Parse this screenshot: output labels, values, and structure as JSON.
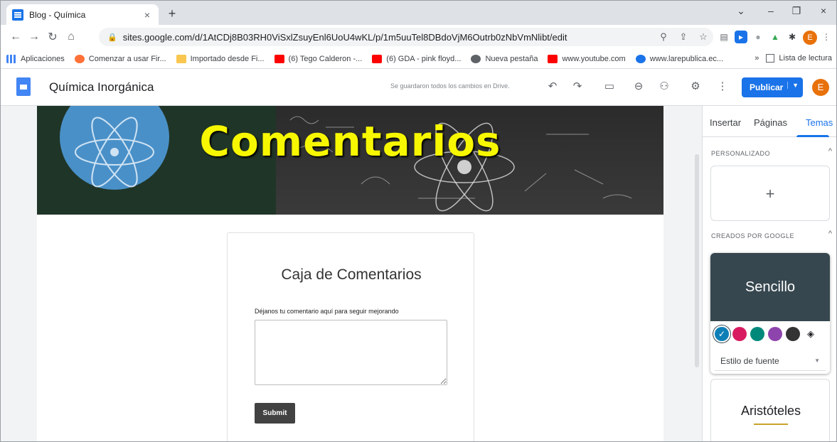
{
  "browser": {
    "tab_title": "Blog - Química",
    "tab_close": "×",
    "new_tab": "+",
    "url": "sites.google.com/d/1AtCDj8B03RH0ViSxlZsuyEnl6UoU4wKL/p/1m5uuTel8DBdoVjM6Outrb0zNbVmNlibt/edit",
    "profile_initial": "E",
    "window_controls": {
      "minimize": "–",
      "restore": "❐",
      "close": "×"
    }
  },
  "bookmarks": {
    "items": [
      {
        "label": "Aplicaciones",
        "color": "#4285f4"
      },
      {
        "label": "Comenzar a usar Fir...",
        "color": "#ff7139"
      },
      {
        "label": "Importado desde Fi...",
        "color": "#f9c74f"
      },
      {
        "label": "(6) Tego Calderon -...",
        "color": "#ff0000"
      },
      {
        "label": "(6) GDA - pink floyd...",
        "color": "#ff0000"
      },
      {
        "label": "Nueva pestaña",
        "color": "#5f6368"
      },
      {
        "label": "www.youtube.com",
        "color": "#ff0000"
      },
      {
        "label": "www.larepublica.ec...",
        "color": "#1a73e8"
      }
    ],
    "overflow": "»",
    "reading_list": "Lista de lectura"
  },
  "sites": {
    "site_name": "Química Inorgánica",
    "saved_message": "Se guardaron todos los cambios en Drive.",
    "publish_label": "Publicar",
    "user_initial": "E"
  },
  "page": {
    "banner_title": "Comentarios",
    "form_title": "Caja de Comentarios",
    "field_label": "Déjanos tu comentario aquí para seguir mejorando",
    "submit_label": "Submit"
  },
  "panel": {
    "tabs": [
      "Insertar",
      "Páginas",
      "Temas"
    ],
    "active_tab": "Temas",
    "custom_heading": "PERSONALIZADO",
    "add_symbol": "+",
    "google_heading": "CREADOS POR GOOGLE",
    "theme1_name": "Sencillo",
    "theme1_font_select": "Estilo de fuente",
    "theme1_swatches": [
      "#0e7fb6",
      "#d81b60",
      "#00897b",
      "#8e44ad",
      "#333333"
    ],
    "theme2_name": "Aristóteles",
    "theme2_accent": "#c9a227"
  },
  "colors": {
    "accent": "#1a73e8",
    "banner_text": "#f7f700",
    "theme_dark": "#37474f"
  }
}
